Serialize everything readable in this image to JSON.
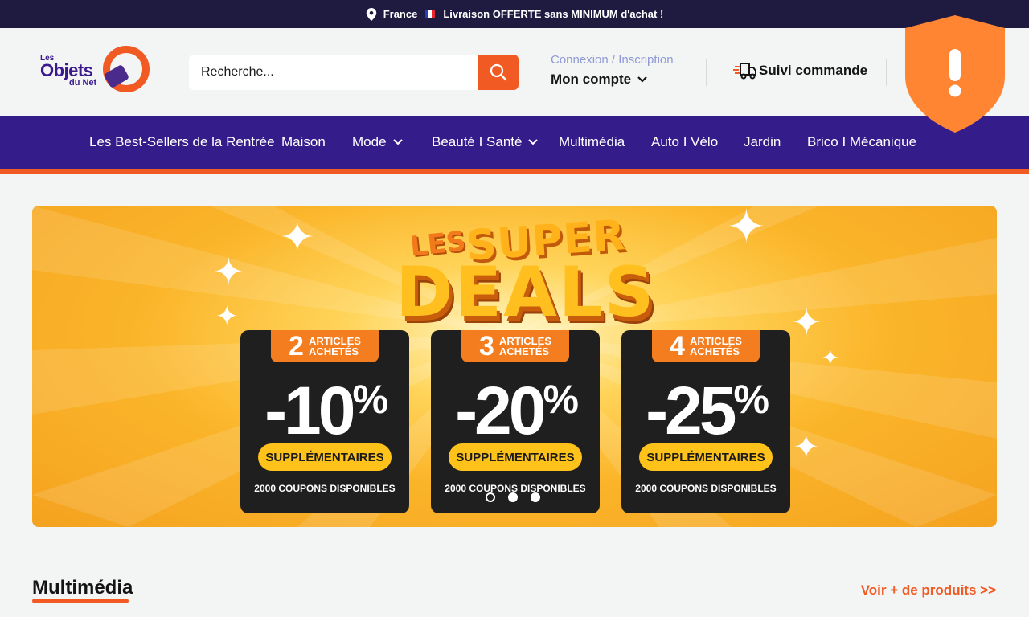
{
  "announcement": {
    "country": "France",
    "text": "Livraison OFFERTE sans MINIMUM d'achat !",
    "icon": "map-pin-icon"
  },
  "header": {
    "logo": {
      "line1": "Les",
      "line2": "Objets",
      "line3": "du Net"
    },
    "search": {
      "placeholder": "Recherche...",
      "icon": "search-icon"
    },
    "account": {
      "links": "Connexion / Inscription",
      "label": "Mon compte"
    },
    "tracking": {
      "label": "Suivi commande",
      "icon": "truck-icon"
    }
  },
  "nav": {
    "items": [
      {
        "label": "Les Best-Sellers de la Rentrée",
        "dropdown": false
      },
      {
        "label": "Maison",
        "dropdown": false
      },
      {
        "label": "Mode",
        "dropdown": true
      },
      {
        "label": "Beauté I Santé",
        "dropdown": true
      },
      {
        "label": "Multimédia",
        "dropdown": false
      },
      {
        "label": "Auto I Vélo",
        "dropdown": false
      },
      {
        "label": "Jardin",
        "dropdown": false
      },
      {
        "label": "Brico I Mécanique",
        "dropdown": false
      }
    ]
  },
  "hero": {
    "title_les": "LES",
    "title_super": "SUPER",
    "title_deals": "DEALS",
    "coupons": [
      {
        "count": "2",
        "articles": "ARTICLES",
        "achetes": "ACHETÉS",
        "discount": "-10",
        "unit": "%",
        "pill": "SUPPLÉMENTAIRES",
        "footer": "2000 COUPONS DISPONIBLES"
      },
      {
        "count": "3",
        "articles": "ARTICLES",
        "achetes": "ACHETÉS",
        "discount": "-20",
        "unit": "%",
        "pill": "SUPPLÉMENTAIRES",
        "footer": "2000 COUPONS DISPONIBLES"
      },
      {
        "count": "4",
        "articles": "ARTICLES",
        "achetes": "ACHETÉS",
        "discount": "-25",
        "unit": "%",
        "pill": "SUPPLÉMENTAIRES",
        "footer": "2000 COUPONS DISPONIBLES"
      }
    ],
    "slides": 3,
    "active_slide": 1
  },
  "section": {
    "title": "Multimédia",
    "link": "Voir + de produits >>"
  },
  "colors": {
    "accent": "#f15a22",
    "nav_bg": "#341c8a",
    "topbar_bg": "#1f1a40",
    "link_muted": "#8e9ad6",
    "shield": "#ff8533"
  }
}
